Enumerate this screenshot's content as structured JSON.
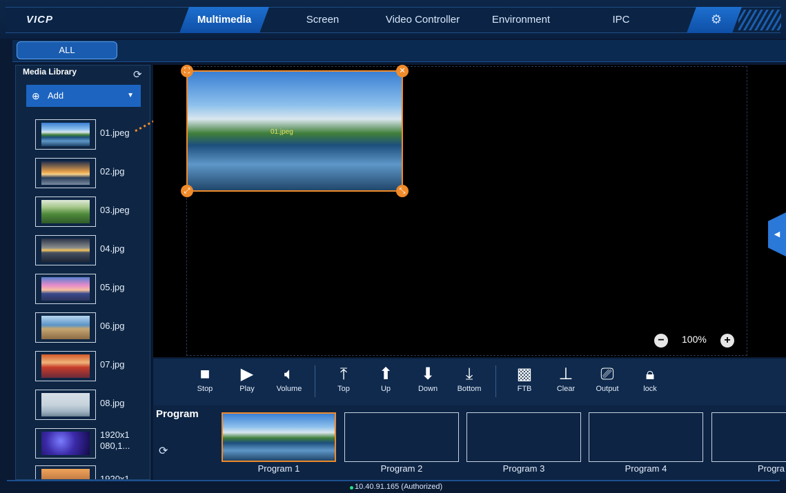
{
  "app": {
    "logo": "VICP",
    "settings_icon": "gear-icon"
  },
  "nav": {
    "tabs": [
      "Multimedia",
      "Screen",
      "Video Controller",
      "Environment",
      "IPC"
    ],
    "active": "Multimedia"
  },
  "filter": {
    "all_label": "ALL"
  },
  "sidebar": {
    "title": "Media Library",
    "add_label": "Add",
    "items": [
      {
        "name": "01.jpeg",
        "thumb": "temple"
      },
      {
        "name": "02.jpg",
        "thumb": "sunset"
      },
      {
        "name": "03.jpeg",
        "thumb": "green"
      },
      {
        "name": "04.jpg",
        "thumb": "dusk"
      },
      {
        "name": "05.jpg",
        "thumb": "pier"
      },
      {
        "name": "06.jpg",
        "thumb": "dock"
      },
      {
        "name": "07.jpg",
        "thumb": "red"
      },
      {
        "name": "08.jpg",
        "thumb": "calm"
      },
      {
        "name": "1920x1\n080,1...",
        "thumb": "purple"
      },
      {
        "name": "1920x1",
        "thumb": "warm"
      }
    ]
  },
  "canvas": {
    "zoom": "100%",
    "layer_label": "01.jpeg"
  },
  "toolbar": {
    "stop": "Stop",
    "play": "Play",
    "volume": "Volume",
    "top": "Top",
    "up": "Up",
    "down": "Down",
    "bottom": "Bottom",
    "ftb": "FTB",
    "clear": "Clear",
    "output": "Output",
    "lock": "lock"
  },
  "programs": {
    "title": "Program",
    "items": [
      "Program 1",
      "Program 2",
      "Program 3",
      "Program 4",
      "Progra"
    ]
  },
  "status": {
    "text": "10.40.91.165 (Authorized)",
    "color": "#27e07a"
  },
  "colors": {
    "accent": "#1c64c0",
    "selection": "#f08a2a",
    "background": "#0a1a33"
  }
}
